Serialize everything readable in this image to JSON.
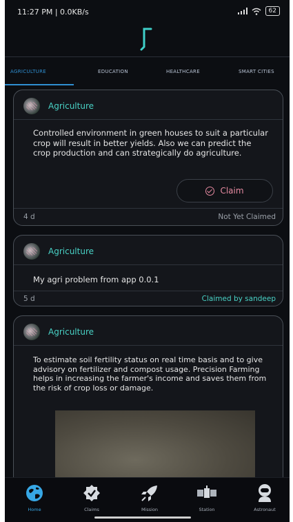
{
  "status": {
    "time": "11:27 PM | 0.0KB/s",
    "battery": "62"
  },
  "tabs": [
    {
      "label": "AGRICULTURE",
      "active": true
    },
    {
      "label": "EDUCATION",
      "active": false
    },
    {
      "label": "HEALTHCARE",
      "active": false
    },
    {
      "label": "SMART CITIES",
      "active": false
    }
  ],
  "cards": [
    {
      "category": "Agriculture",
      "description": "Controlled environment in green houses to suit a particular crop will result in better yields. Also we can predict the crop production and can strategically do agriculture.",
      "claim_label": "Claim",
      "age": "4 d",
      "status": "Not Yet Claimed"
    },
    {
      "category": "Agriculture",
      "description": "My agri problem from app 0.0.1",
      "age": "5 d",
      "status": "Claimed by sandeep"
    },
    {
      "category": "Agriculture",
      "description": "To estimate soil fertility status on real time basis and to give advisory on fertilizer and compost usage. Precision Farming helps in increasing the farmer's income and saves them from the risk of crop loss or damage."
    }
  ],
  "nav": [
    {
      "label": "Home",
      "icon": "globe-icon",
      "active": true
    },
    {
      "label": "Claims",
      "icon": "badge-check-icon",
      "active": false
    },
    {
      "label": "Mission",
      "icon": "rocket-icon",
      "active": false
    },
    {
      "label": "Station",
      "icon": "satellite-icon",
      "active": false
    },
    {
      "label": "Astronaut",
      "icon": "astronaut-icon",
      "active": false
    }
  ],
  "colors": {
    "accent": "#49d2c6",
    "active_tab": "#2f8fd2",
    "claim": "#e58aa0",
    "background": "#0c0e12"
  }
}
